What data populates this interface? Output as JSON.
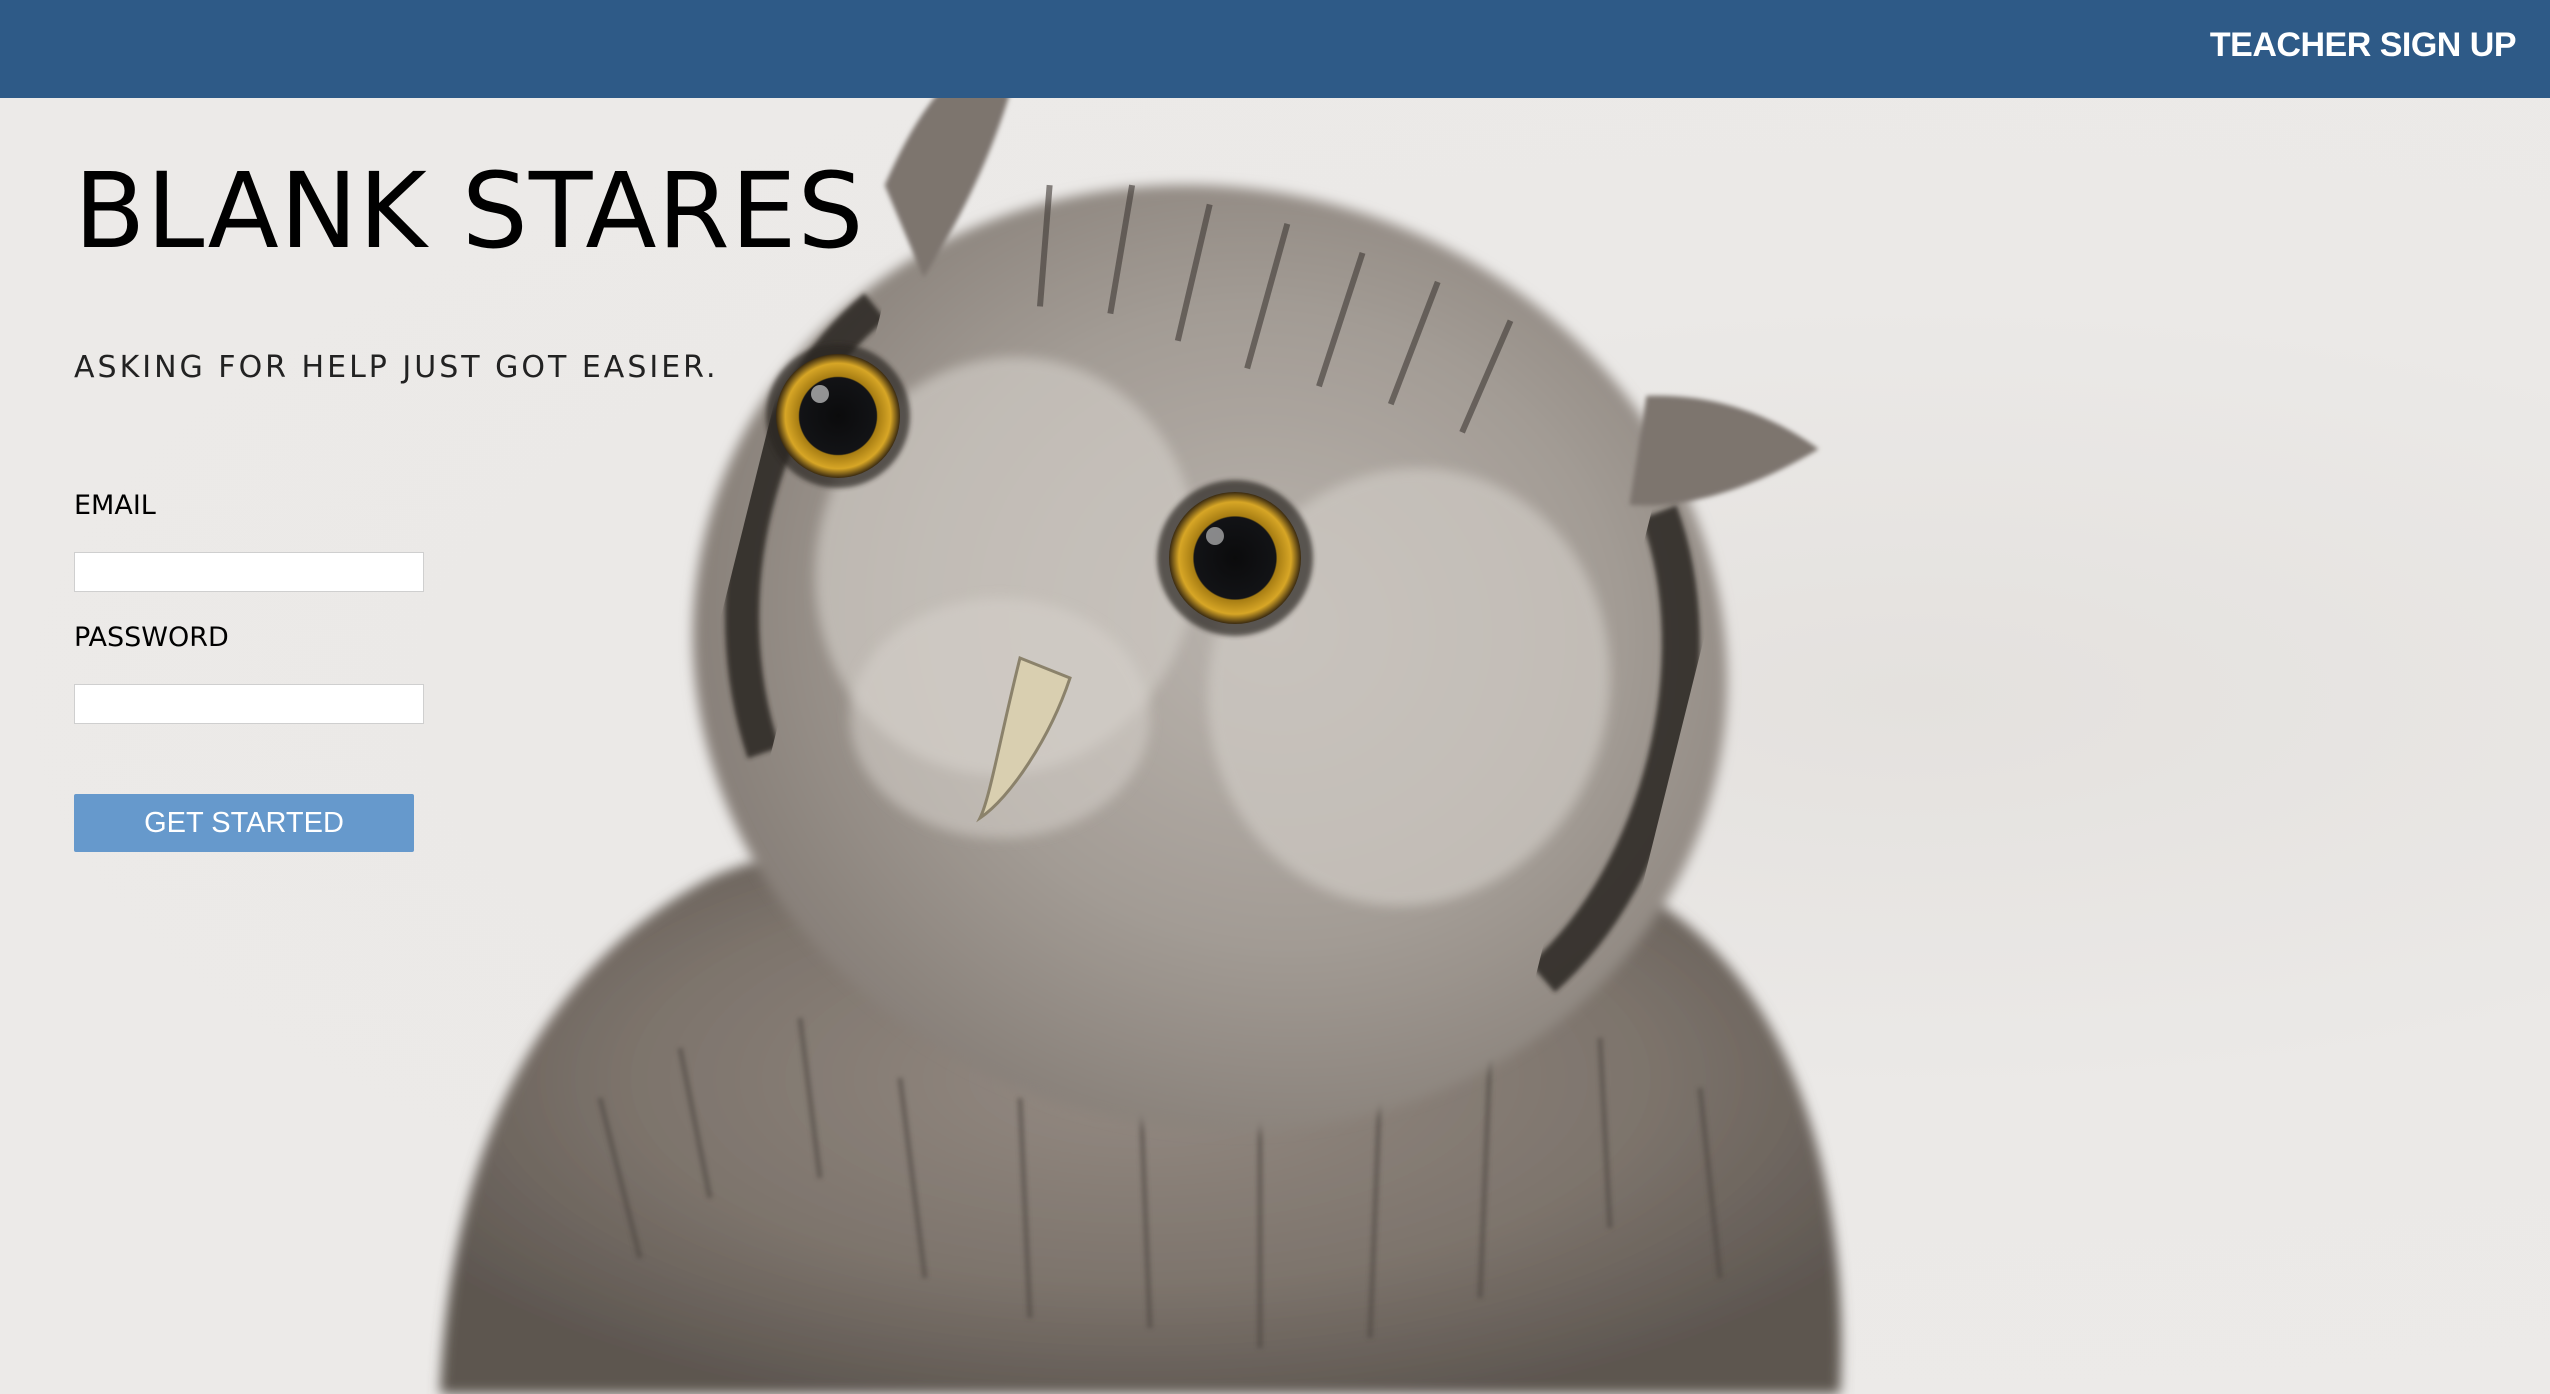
{
  "header": {
    "signup_link": "TEACHER SIGN UP",
    "background_color": "#2e5a87"
  },
  "hero": {
    "title": "BLANK STARES",
    "tagline": "ASKING FOR HELP JUST GOT EASIER.",
    "image_subject": "owl-photo"
  },
  "login_form": {
    "email_label": "EMAIL",
    "email_value": "",
    "password_label": "PASSWORD",
    "password_value": "",
    "submit_label": "GET STARTED",
    "submit_color": "#6699cc"
  }
}
